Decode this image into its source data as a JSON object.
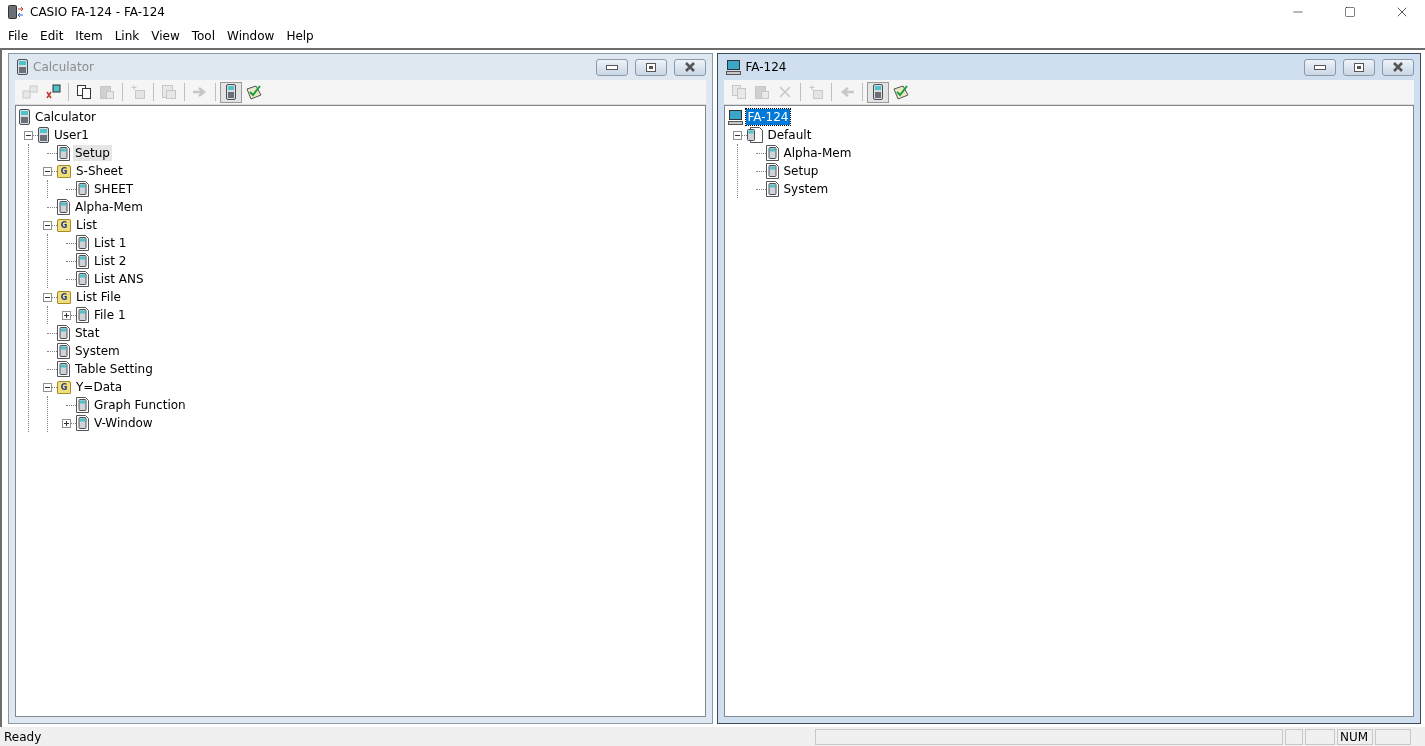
{
  "window": {
    "title": "CASIO FA-124 - FA-124"
  },
  "menu": [
    "File",
    "Edit",
    "Item",
    "Link",
    "View",
    "Tool",
    "Window",
    "Help"
  ],
  "panes": [
    {
      "title": "Calculator",
      "active": false,
      "toolbar": [
        {
          "kind": "transfer",
          "disabled": true,
          "pressed": false
        },
        {
          "kind": "receive",
          "disabled": false,
          "pressed": false
        },
        {
          "kind": "separator"
        },
        {
          "kind": "copy",
          "disabled": false,
          "pressed": false
        },
        {
          "kind": "paste",
          "disabled": true,
          "pressed": false
        },
        {
          "kind": "separator"
        },
        {
          "kind": "new",
          "disabled": true,
          "pressed": false
        },
        {
          "kind": "separator"
        },
        {
          "kind": "image",
          "disabled": true,
          "pressed": false
        },
        {
          "kind": "separator"
        },
        {
          "kind": "send",
          "disabled": true,
          "pressed": false
        },
        {
          "kind": "separator"
        },
        {
          "kind": "calculator",
          "disabled": false,
          "pressed": true
        },
        {
          "kind": "check",
          "disabled": false,
          "pressed": false
        }
      ],
      "tree": [
        {
          "label": "Calculator",
          "kind": "calc",
          "selected": false,
          "children": [
            {
              "label": "User1",
              "kind": "calc",
              "selected": false,
              "expanded": true,
              "children": [
                {
                  "label": "Setup",
                  "kind": "data",
                  "selected": true
                },
                {
                  "label": "S-Sheet",
                  "kind": "group",
                  "badge": "G",
                  "selected": false,
                  "expanded": true,
                  "children": [
                    {
                      "label": "SHEET",
                      "kind": "data",
                      "selected": false
                    }
                  ]
                },
                {
                  "label": "Alpha-Mem",
                  "kind": "data",
                  "selected": false
                },
                {
                  "label": "List",
                  "kind": "group",
                  "badge": "G",
                  "selected": false,
                  "expanded": true,
                  "children": [
                    {
                      "label": "List 1",
                      "kind": "data",
                      "selected": false
                    },
                    {
                      "label": "List 2",
                      "kind": "data",
                      "selected": false
                    },
                    {
                      "label": "List ANS",
                      "kind": "data",
                      "selected": false
                    }
                  ]
                },
                {
                  "label": "List File",
                  "kind": "group",
                  "badge": "G",
                  "selected": false,
                  "expanded": true,
                  "children": [
                    {
                      "label": "File 1",
                      "kind": "data",
                      "selected": false,
                      "expanded": false
                    }
                  ]
                },
                {
                  "label": "Stat",
                  "kind": "data",
                  "selected": false
                },
                {
                  "label": "System",
                  "kind": "data",
                  "selected": false
                },
                {
                  "label": "Table Setting",
                  "kind": "data",
                  "selected": false
                },
                {
                  "label": "Y=Data",
                  "kind": "group",
                  "badge": "G",
                  "selected": false,
                  "expanded": true,
                  "children": [
                    {
                      "label": "Graph Function",
                      "kind": "data",
                      "selected": false
                    },
                    {
                      "label": "V-Window",
                      "kind": "data",
                      "selected": false,
                      "expanded": false
                    }
                  ]
                }
              ]
            }
          ]
        }
      ]
    },
    {
      "title": "FA-124",
      "active": true,
      "toolbar": [
        {
          "kind": "copy",
          "disabled": true,
          "pressed": false
        },
        {
          "kind": "paste",
          "disabled": true,
          "pressed": false
        },
        {
          "kind": "delete",
          "disabled": true,
          "pressed": false
        },
        {
          "kind": "separator"
        },
        {
          "kind": "new",
          "disabled": true,
          "pressed": false
        },
        {
          "kind": "separator"
        },
        {
          "kind": "back",
          "disabled": true,
          "pressed": false
        },
        {
          "kind": "separator"
        },
        {
          "kind": "calculator",
          "disabled": false,
          "pressed": true
        },
        {
          "kind": "check",
          "disabled": false,
          "pressed": false
        }
      ],
      "tree": [
        {
          "label": "FA-124",
          "kind": "computer",
          "selected": true,
          "children": [
            {
              "label": "Default",
              "kind": "document",
              "selected": false,
              "expanded": true,
              "children": [
                {
                  "label": "Alpha-Mem",
                  "kind": "data",
                  "selected": false
                },
                {
                  "label": "Setup",
                  "kind": "data",
                  "selected": false
                },
                {
                  "label": "System",
                  "kind": "data",
                  "selected": false
                }
              ]
            }
          ]
        }
      ]
    }
  ],
  "status_bar": {
    "text": "Ready",
    "indicators": [
      "NUM"
    ]
  }
}
